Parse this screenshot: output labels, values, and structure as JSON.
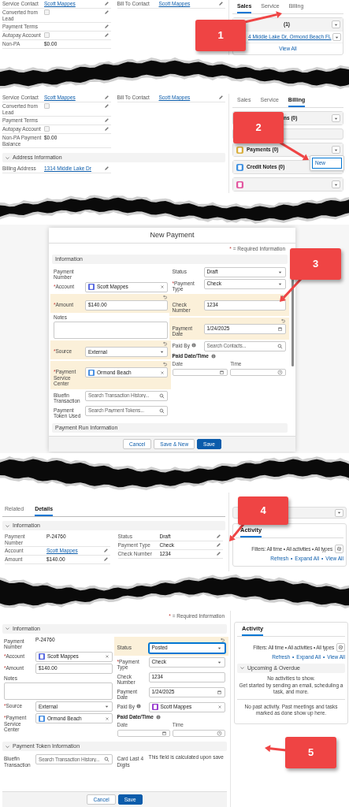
{
  "panel_1": {
    "left_fields": [
      {
        "label": "Service Contact",
        "kind": "link",
        "value": "Scott Mappes",
        "editable": true
      },
      {
        "label": "Converted from Lead",
        "kind": "checkbox",
        "checked": false,
        "editable": true
      },
      {
        "label": "Payment Terms",
        "kind": "text",
        "editable": true
      },
      {
        "label": "Autopay Account",
        "kind": "checkbox",
        "checked": false,
        "editable": true
      },
      {
        "label": "Non-PA",
        "kind": "text",
        "value": "$0.00",
        "editable": false
      }
    ],
    "right_fields": [
      {
        "label": "Bill To Contact",
        "kind": "link",
        "value": "Scott Mappes",
        "editable": true
      }
    ],
    "sidebar": {
      "tabs": [
        {
          "label": "Sales",
          "selected": true
        },
        {
          "label": "Service",
          "selected": false
        },
        {
          "label": "Billing",
          "selected": false
        }
      ],
      "cards": [
        {
          "kind": "partial",
          "title": "(1)",
          "menu_button": true,
          "items": [
            "4 Middle Lake Dr, Ormond Beach FL"
          ],
          "footer": "View All"
        }
      ]
    },
    "callout": {
      "number": "1"
    }
  },
  "panel_2": {
    "left_fields": [
      {
        "label": "Service Contact",
        "kind": "link",
        "value": "Scott Mappes",
        "editable": true
      },
      {
        "label": "Converted from Lead",
        "kind": "checkbox",
        "checked": false,
        "editable": true
      },
      {
        "label": "Payment Terms",
        "kind": "text",
        "editable": true
      },
      {
        "label": "Autopay Account",
        "kind": "checkbox",
        "checked": false,
        "editable": true
      },
      {
        "label": "Non-PA Payment Balance",
        "kind": "text",
        "value": "$0.00",
        "editable": false
      }
    ],
    "right_fields": [
      {
        "label": "Bill To Contact",
        "kind": "link",
        "value": "Scott Mappes",
        "editable": true
      }
    ],
    "sections": [
      {
        "title": "Address Information",
        "fields": [
          {
            "label": "Billing Address",
            "kind": "link",
            "value": "1314 Middle Lake Dr",
            "editable": true
          }
        ]
      }
    ],
    "sidebar": {
      "tabs": [
        {
          "label": "Sales",
          "selected": false
        },
        {
          "label": "Service",
          "selected": false
        },
        {
          "label": "Billing",
          "selected": true
        }
      ],
      "cards": [
        {
          "kind": "partial",
          "title": "ns (0)",
          "menu_button": true
        },
        {
          "kind": "blank"
        },
        {
          "kind": "list",
          "title": "Payments (0)",
          "color": "#d9ae3c",
          "menu_button": true,
          "menu": [
            {
              "label": "New",
              "selected": true
            }
          ]
        },
        {
          "kind": "list",
          "title": "Credit Notes (0)",
          "color": "#3d8fe0",
          "menu_button": false
        },
        {
          "kind": "list",
          "color": "#e2559f",
          "menu_button": true
        }
      ]
    },
    "callout": {
      "number": "2"
    }
  },
  "panel_3": {
    "title": "New Payment",
    "required_note": {
      "mark": "*",
      "text": "= Required Information"
    },
    "sections": [
      {
        "title": "Information",
        "columns": [
          [
            {
              "label": "Payment Number",
              "kind": "readonly",
              "edited": false
            },
            {
              "label": "Account",
              "mark": "*",
              "kind": "lookup",
              "value": "Scott Mappes",
              "color": "#5b6be0",
              "edited": false
            },
            {
              "label": "Amount",
              "mark": "*",
              "kind": "text",
              "value": "$140.00",
              "edited": true
            },
            {
              "label": "Notes",
              "kind": "textarea",
              "edited": false
            },
            {
              "label": "Source",
              "mark": "*",
              "kind": "select",
              "value": "External",
              "edited": true
            },
            {
              "label": "Payment Service Center",
              "mark": "*",
              "kind": "lookup",
              "value": "Ormond Beach",
              "color": "#4a90e2",
              "edited": true
            },
            {
              "label": "Bluefin Transaction",
              "kind": "search",
              "placeholder": "Search Transaction History...",
              "edited": false
            },
            {
              "label": "Payment Token Used",
              "kind": "search",
              "placeholder": "Search Payment Tokens...",
              "edited": false
            }
          ],
          [
            {
              "label": "Status",
              "kind": "select",
              "value": "Draft",
              "edited": false
            },
            {
              "label": "Payment Type",
              "mark": "*",
              "kind": "select",
              "value": "Check",
              "edited": false
            },
            {
              "label": "Check Number",
              "kind": "text",
              "value": "1234",
              "edited": true
            },
            {
              "label": "Payment Date",
              "kind": "date",
              "value": "1/24/2025",
              "edited": true
            },
            {
              "label": "Paid By",
              "kind": "search",
              "placeholder": "Search Contacts...",
              "help": true,
              "edited": false
            },
            {
              "label": "Paid Date/Time",
              "kind": "datetime",
              "date_label": "Date",
              "time_label": "Time",
              "help": true,
              "edited": false
            }
          ]
        ]
      },
      {
        "title": "Payment Run Information"
      }
    ],
    "buttons": [
      {
        "label": "Cancel",
        "kind": "neutral"
      },
      {
        "label": "Save & New",
        "kind": "neutral"
      },
      {
        "label": "Save",
        "kind": "brand"
      }
    ],
    "callout": {
      "number": "3"
    }
  },
  "panel_4": {
    "tabs": [
      {
        "label": "Related",
        "selected": false
      },
      {
        "label": "Details",
        "selected": true
      }
    ],
    "section": {
      "title": "Information",
      "left_fields": [
        {
          "label": "Payment Number",
          "kind": "text",
          "value": "P-24760",
          "editable": false
        },
        {
          "label": "Account",
          "kind": "link",
          "value": "Scott Mappes",
          "editable": true
        },
        {
          "label": "Amount",
          "kind": "text",
          "value": "$140.00",
          "editable": true
        }
      ],
      "right_fields": [
        {
          "label": "Status",
          "kind": "text",
          "value": "Draft",
          "editable": true
        },
        {
          "label": "Payment Type",
          "kind": "text",
          "value": "Check",
          "editable": true
        },
        {
          "label": "Check Number",
          "kind": "text",
          "value": "1234",
          "editable": true
        }
      ]
    },
    "activity": {
      "tabs": [
        {
          "label": "Activity",
          "selected": true
        }
      ],
      "filters": "Filters: All time • All activities • All types",
      "links": [
        "Refresh",
        "Expand All",
        "View All"
      ],
      "separator": "•"
    },
    "callout": {
      "number": "4"
    }
  },
  "panel_5": {
    "required_note": {
      "mark": "*",
      "text": "= Required Information"
    },
    "sections": [
      {
        "title": "Information",
        "columns": [
          [
            {
              "label": "Payment Number",
              "kind": "readonly",
              "value": "P-24760",
              "edited": false
            },
            {
              "label": "Account",
              "mark": "*",
              "kind": "lookup",
              "value": "Scott Mappes",
              "color": "#5b6be0",
              "edited": false
            },
            {
              "label": "Amount",
              "mark": "*",
              "kind": "text",
              "value": "$140.00",
              "edited": false
            },
            {
              "label": "Notes",
              "kind": "textarea",
              "edited": false
            },
            {
              "label": "Source",
              "mark": "*",
              "kind": "select",
              "value": "External",
              "edited": false
            },
            {
              "label": "Payment Service Center",
              "mark": "*",
              "kind": "lookup",
              "value": "Ormond Beach",
              "color": "#4a90e2",
              "edited": false
            }
          ],
          [
            {
              "label": "Status",
              "kind": "select",
              "value": "Posted",
              "edited": true,
              "focused": true
            },
            {
              "label": "Payment Type",
              "mark": "*",
              "kind": "select",
              "value": "Check",
              "edited": false
            },
            {
              "label": "Check Number",
              "kind": "text",
              "value": "1234",
              "edited": false
            },
            {
              "label": "Payment Date",
              "kind": "date",
              "value": "1/24/2025",
              "edited": false
            },
            {
              "label": "Paid By",
              "kind": "lookup",
              "value": "Scott Mappes",
              "color": "#9a3fd0",
              "help": true,
              "edited": false
            },
            {
              "label": "Paid Date/Time",
              "kind": "datetime",
              "date_label": "Date",
              "time_label": "Time",
              "help": true,
              "edited": false
            }
          ]
        ]
      },
      {
        "title": "Payment Token Information",
        "columns": [
          [
            {
              "label": "Bluefin Transaction",
              "kind": "search",
              "placeholder": "Search Transaction History...",
              "edited": false
            }
          ],
          [
            {
              "label": "Card Last 4 Digits",
              "kind": "note",
              "value": "This field is calculated upon save",
              "edited": false
            }
          ]
        ]
      }
    ],
    "buttons": [
      {
        "label": "Cancel",
        "kind": "neutral"
      },
      {
        "label": "Save",
        "kind": "brand"
      }
    ],
    "activity": {
      "tabs": [
        {
          "label": "Activity",
          "selected": true
        }
      ],
      "filters": "Filters: All time • All activities • All types",
      "links": [
        "Refresh",
        "Expand All",
        "View All"
      ],
      "separator": "•",
      "upcoming": {
        "title": "Upcoming & Overdue",
        "message": "No activities to show.",
        "hint": "Get started by sending an email, scheduling a task, and more."
      },
      "past": "No past activity. Past meetings and tasks marked as done show up here."
    },
    "callout": {
      "number": "5"
    }
  }
}
